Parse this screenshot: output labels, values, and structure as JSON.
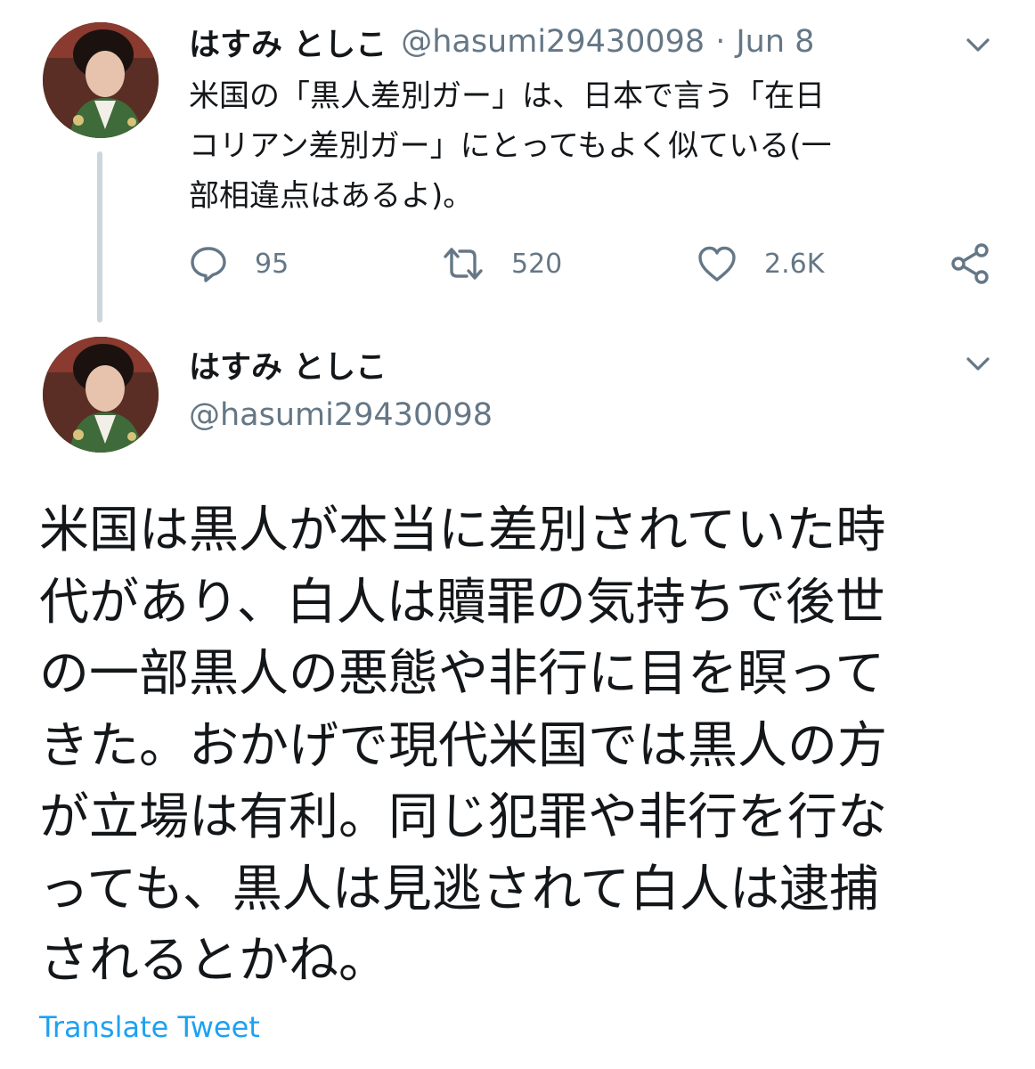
{
  "tweet1": {
    "display_name": "はすみ としこ",
    "handle": "@hasumi29430098",
    "separator": "·",
    "date": "Jun 8",
    "text": "米国の「黒人差別ガー」は、日本で言う「在日\nコリアン差別ガー」にとってもよく似ている(一\n部相違点はあるよ)。",
    "replies": "95",
    "retweets": "520",
    "likes": "2.6K"
  },
  "tweet2": {
    "display_name": "はすみ としこ",
    "handle": "@hasumi29430098",
    "text": "米国は黒人が本当に差別されていた時\n代があり、白人は贖罪の気持ちで後世\nの一部黒人の悪態や非行に目を瞑って\nきた。おかげで現代米国では黒人の方\nが立場は有利。同じ犯罪や非行を行な\nっても、黒人は見逃されて白人は逮捕\nされるとかね。",
    "translate_label": "Translate Tweet"
  },
  "icons": {
    "reply": "reply-icon",
    "retweet": "retweet-icon",
    "like": "heart-icon",
    "share": "share-icon",
    "caret": "chevron-down-icon"
  },
  "colors": {
    "text": "#14171a",
    "secondary": "#657786",
    "link": "#1da1f2",
    "thread_line": "#ccd6dd"
  }
}
